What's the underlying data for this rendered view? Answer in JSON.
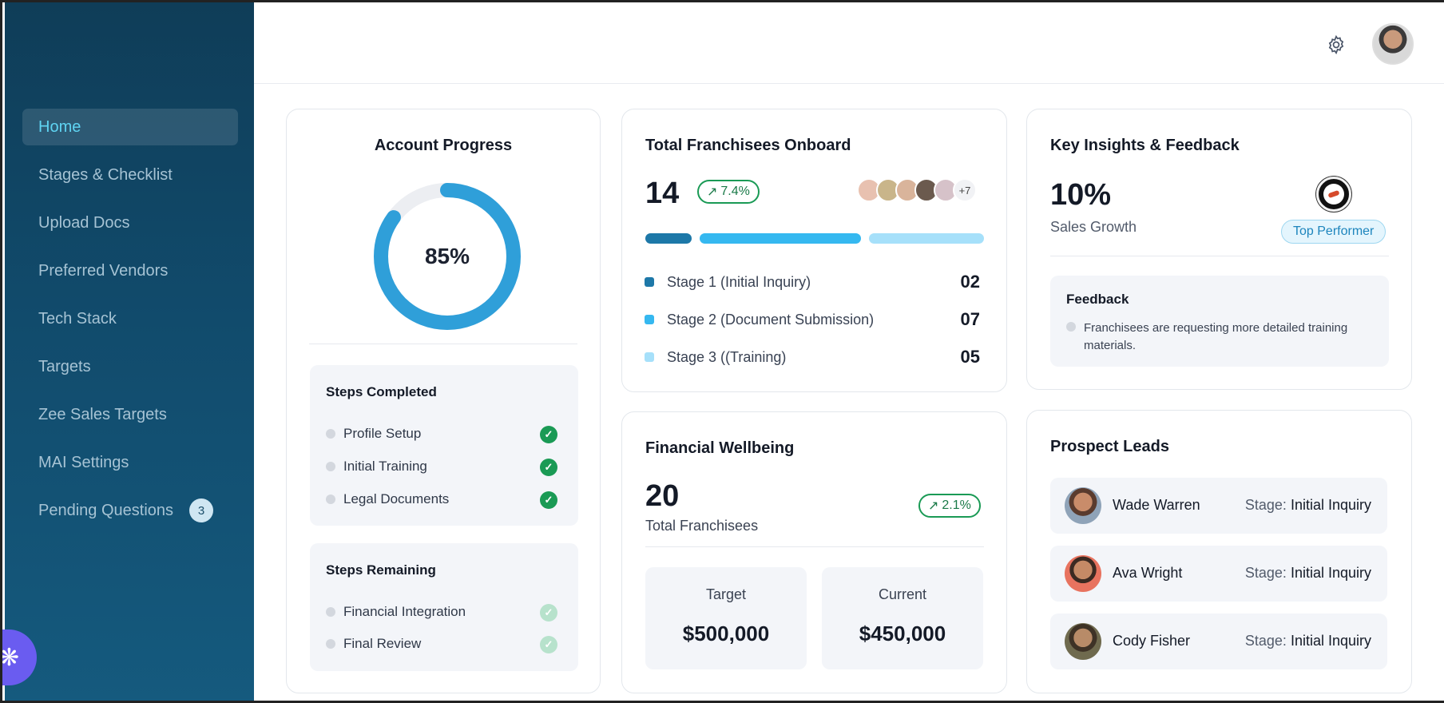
{
  "sidebar": {
    "items": [
      {
        "label": "Home"
      },
      {
        "label": "Stages & Checklist"
      },
      {
        "label": "Upload Docs"
      },
      {
        "label": "Preferred Vendors"
      },
      {
        "label": "Tech Stack"
      },
      {
        "label": "Targets"
      },
      {
        "label": "Zee Sales Targets"
      },
      {
        "label": "MAI Settings"
      },
      {
        "label": "Pending Questions",
        "badge": "3"
      }
    ],
    "active_index": 0
  },
  "account_progress": {
    "title": "Account Progress",
    "percent_label": "85%",
    "percent_value": 0.85,
    "steps_completed": {
      "title": "Steps Completed",
      "items": [
        "Profile Setup",
        "Initial Training",
        "Legal Documents"
      ]
    },
    "steps_remaining": {
      "title": "Steps Remaining",
      "items": [
        "Financial Integration",
        "Final Review"
      ]
    }
  },
  "franchisees": {
    "title": "Total Franchisees Onboard",
    "count": "14",
    "change": "7.4%",
    "more_avatars": "+7",
    "stages": [
      {
        "label": "Stage 1 (Initial Inquiry)",
        "value": "02",
        "color": "#1d78a8"
      },
      {
        "label": "Stage 2 (Document Submission)",
        "value": "07",
        "color": "#35b8f0"
      },
      {
        "label": "Stage 3 ((Training)",
        "value": "05",
        "color": "#a6e0fa"
      }
    ]
  },
  "insights": {
    "title": "Key Insights & Feedback",
    "growth": "10%",
    "growth_label": "Sales Growth",
    "badge": "Top Performer",
    "feedback_title": "Feedback",
    "feedback_items": [
      "Franchisees are requesting more detailed training materials."
    ]
  },
  "financial": {
    "title": "Financial Wellbeing",
    "count": "20",
    "count_label": "Total Franchisees",
    "change": "2.1%",
    "target_label": "Target",
    "target_value": "$500,000",
    "current_label": "Current",
    "current_value": "$450,000"
  },
  "leads": {
    "title": "Prospect Leads",
    "stage_prefix": "Stage:",
    "items": [
      {
        "name": "Wade Warren",
        "stage": "Initial Inquiry"
      },
      {
        "name": "Ava Wright",
        "stage": "Initial Inquiry"
      },
      {
        "name": "Cody Fisher",
        "stage": "Initial Inquiry"
      }
    ]
  },
  "colors": {
    "accent": "#2f9fd9",
    "success": "#1a9a55",
    "sidebar_active_text": "#5fd4f2"
  }
}
